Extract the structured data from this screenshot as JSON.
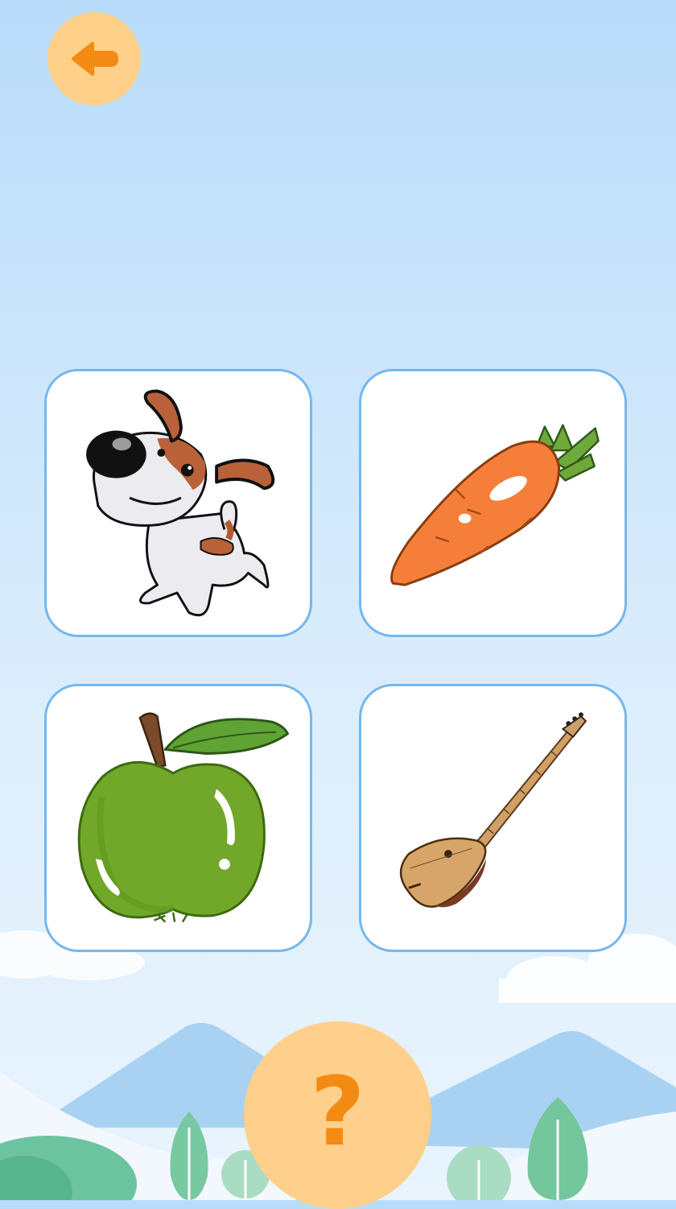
{
  "header": {
    "back_button": {
      "icon": "back-arrow-icon"
    }
  },
  "options": [
    {
      "id": "dog",
      "icon": "dog-picture"
    },
    {
      "id": "carrot",
      "icon": "carrot-picture"
    },
    {
      "id": "apple",
      "icon": "apple-picture"
    },
    {
      "id": "dombra",
      "icon": "dombra-instrument-picture"
    }
  ],
  "help_button": {
    "label": "?"
  },
  "colors": {
    "accent_orange": "#f38a12",
    "button_peach": "#ffd089",
    "card_border": "#75b7ee",
    "sky": "#b9dcfb"
  }
}
